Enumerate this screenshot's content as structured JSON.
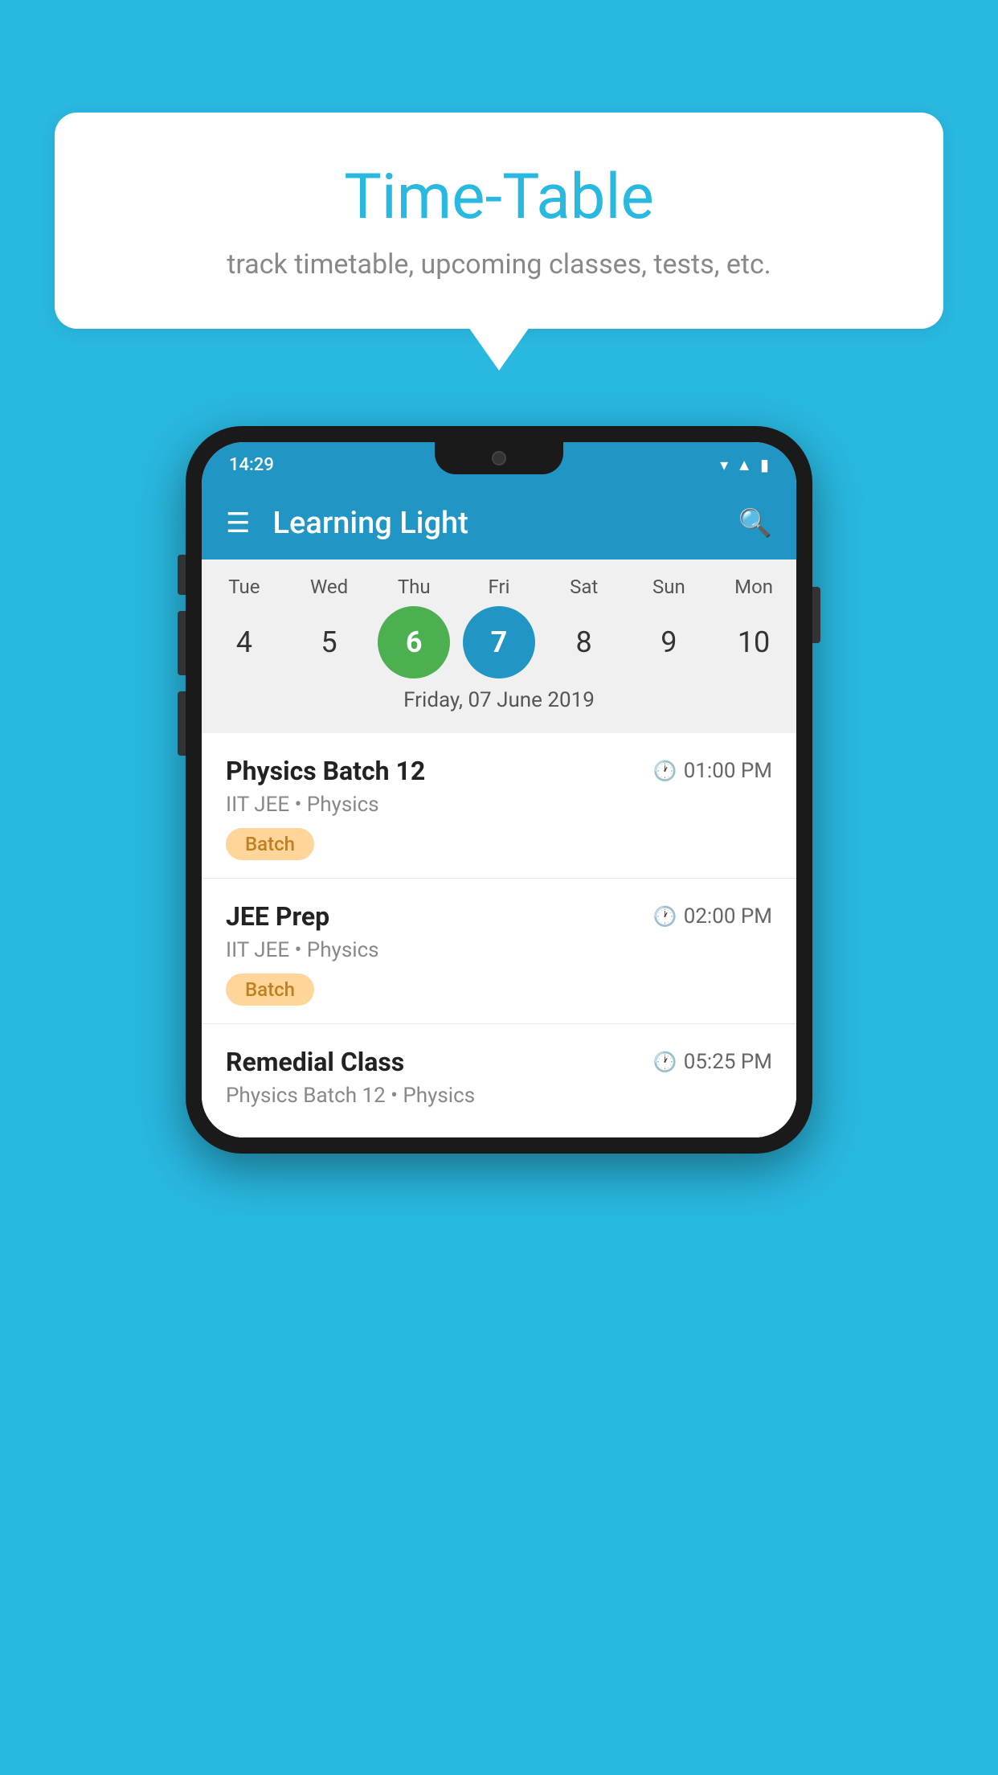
{
  "background_color": "#29b8e0",
  "bubble": {
    "title": "Time-Table",
    "subtitle": "track timetable, upcoming classes, tests, etc."
  },
  "phone": {
    "status_bar": {
      "time": "14:29"
    },
    "app_bar": {
      "title": "Learning Light"
    },
    "calendar": {
      "days": [
        {
          "label": "Tue",
          "num": "4",
          "state": "normal"
        },
        {
          "label": "Wed",
          "num": "5",
          "state": "normal"
        },
        {
          "label": "Thu",
          "num": "6",
          "state": "today"
        },
        {
          "label": "Fri",
          "num": "7",
          "state": "selected"
        },
        {
          "label": "Sat",
          "num": "8",
          "state": "normal"
        },
        {
          "label": "Sun",
          "num": "9",
          "state": "normal"
        },
        {
          "label": "Mon",
          "num": "10",
          "state": "normal"
        }
      ],
      "selected_date_label": "Friday, 07 June 2019"
    },
    "schedule": [
      {
        "title": "Physics Batch 12",
        "time": "01:00 PM",
        "sub": "IIT JEE • Physics",
        "badge": "Batch"
      },
      {
        "title": "JEE Prep",
        "time": "02:00 PM",
        "sub": "IIT JEE • Physics",
        "badge": "Batch"
      },
      {
        "title": "Remedial Class",
        "time": "05:25 PM",
        "sub": "Physics Batch 12 • Physics",
        "badge": null
      }
    ]
  }
}
